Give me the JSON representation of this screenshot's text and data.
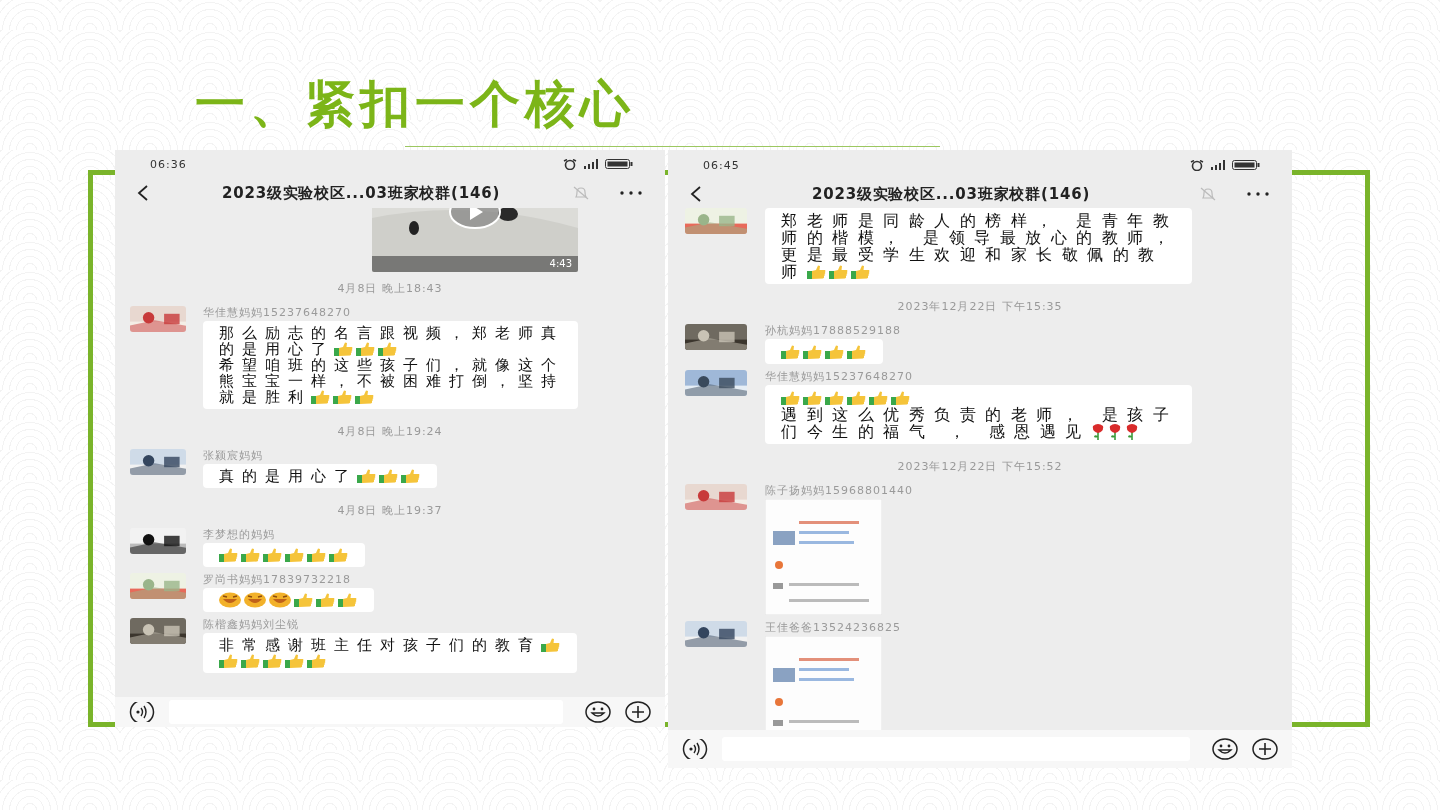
{
  "slide": {
    "title": "一、紧扣一个核心"
  },
  "phones": [
    {
      "status": {
        "time": "06:36"
      },
      "header": {
        "title": "2023级实验校区...03班家校群(146)"
      },
      "messages": [
        {
          "kind": "video",
          "duration": "4:43"
        },
        {
          "kind": "time",
          "text": "4月8日 晚上18:43"
        },
        {
          "kind": "chat",
          "sender": "华佳慧妈妈15237648270",
          "parts": [
            {
              "kind": "text",
              "text": "那么励志的名言跟视频，郑老师真"
            },
            {
              "kind": "break"
            },
            {
              "kind": "text",
              "text": "的是用心了"
            },
            {
              "kind": "thumb"
            },
            {
              "kind": "thumb"
            },
            {
              "kind": "thumb"
            },
            {
              "kind": "break"
            },
            {
              "kind": "text",
              "text": "希望咱班的这些孩子们，就像这个"
            },
            {
              "kind": "break"
            },
            {
              "kind": "text",
              "text": "熊宝宝一样，不被困难打倒，坚持"
            },
            {
              "kind": "break"
            },
            {
              "kind": "text",
              "text": "就是胜利"
            },
            {
              "kind": "thumb"
            },
            {
              "kind": "thumb"
            },
            {
              "kind": "thumb"
            }
          ]
        },
        {
          "kind": "time",
          "text": "4月8日 晚上19:24"
        },
        {
          "kind": "chat",
          "sender": "张颍宸妈妈",
          "parts": [
            {
              "kind": "text",
              "text": "真的是用心了"
            },
            {
              "kind": "thumb"
            },
            {
              "kind": "thumb"
            },
            {
              "kind": "thumb"
            }
          ]
        },
        {
          "kind": "time",
          "text": "4月8日 晚上19:37"
        },
        {
          "kind": "chat",
          "sender": "李梦想的妈妈",
          "parts": [
            {
              "kind": "thumb"
            },
            {
              "kind": "thumb"
            },
            {
              "kind": "thumb"
            },
            {
              "kind": "thumb"
            },
            {
              "kind": "thumb"
            },
            {
              "kind": "thumb"
            }
          ]
        },
        {
          "kind": "chat",
          "sender": "罗尚书妈妈17839732218",
          "parts": [
            {
              "kind": "laugh"
            },
            {
              "kind": "laugh"
            },
            {
              "kind": "laugh"
            },
            {
              "kind": "thumb"
            },
            {
              "kind": "thumb"
            },
            {
              "kind": "thumb"
            }
          ]
        },
        {
          "kind": "chat",
          "sender": "陈楷鑫妈妈刘尘锐",
          "parts": [
            {
              "kind": "text",
              "text": "非常感谢班主任对孩子们的教育"
            },
            {
              "kind": "thumb"
            },
            {
              "kind": "break"
            },
            {
              "kind": "thumb"
            },
            {
              "kind": "thumb"
            },
            {
              "kind": "thumb"
            },
            {
              "kind": "thumb"
            },
            {
              "kind": "thumb"
            }
          ]
        }
      ]
    },
    {
      "status": {
        "time": "06:45"
      },
      "header": {
        "title": "2023级实验校区...03班家校群(146)"
      },
      "messages": [
        {
          "kind": "chat",
          "parts": [
            {
              "kind": "text",
              "text": "郑老师是同龄人的榜样， 是青年教"
            },
            {
              "kind": "break"
            },
            {
              "kind": "text",
              "text": "师的楷模， 是领导最放心的教师，"
            },
            {
              "kind": "break"
            },
            {
              "kind": "text",
              "text": "更是最受学生欢迎和家长敬佩的教"
            },
            {
              "kind": "break"
            },
            {
              "kind": "text",
              "text": "师"
            },
            {
              "kind": "thumb"
            },
            {
              "kind": "thumb"
            },
            {
              "kind": "thumb"
            }
          ]
        },
        {
          "kind": "time",
          "text": "2023年12月22日 下午15:35"
        },
        {
          "kind": "chat",
          "sender": "孙杭妈妈17888529188",
          "parts": [
            {
              "kind": "thumb"
            },
            {
              "kind": "thumb"
            },
            {
              "kind": "thumb"
            },
            {
              "kind": "thumb"
            }
          ]
        },
        {
          "kind": "chat",
          "sender": "华佳慧妈妈15237648270",
          "parts": [
            {
              "kind": "thumb"
            },
            {
              "kind": "thumb"
            },
            {
              "kind": "thumb"
            },
            {
              "kind": "thumb"
            },
            {
              "kind": "thumb"
            },
            {
              "kind": "thumb"
            },
            {
              "kind": "break"
            },
            {
              "kind": "text",
              "text": "遇到这么优秀负责的老师， 是孩子"
            },
            {
              "kind": "break"
            },
            {
              "kind": "text",
              "text": "们今生的福气 ， 感恩遇见"
            },
            {
              "kind": "rose"
            },
            {
              "kind": "rose"
            },
            {
              "kind": "rose"
            }
          ]
        },
        {
          "kind": "time",
          "text": "2023年12月22日 下午15:52"
        },
        {
          "sender": "陈子扬妈妈15968801440"
        },
        {
          "sender": "王佳爸爸13524236825"
        }
      ]
    }
  ]
}
